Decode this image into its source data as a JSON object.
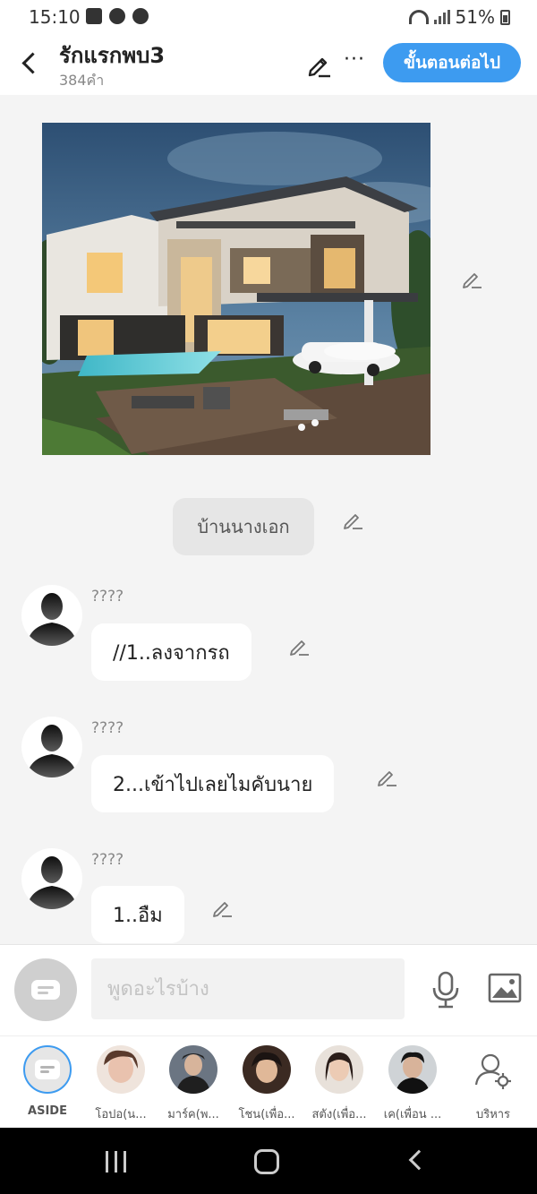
{
  "status": {
    "time": "15:10",
    "battery": "51%"
  },
  "header": {
    "title": "รักแรกพบ3",
    "subtitle": "384คำ",
    "more_label": "···",
    "next_label": "ขั้นตอนต่อไป"
  },
  "chat": {
    "narration": "บ้านนางเอก",
    "messages": [
      {
        "name": "????",
        "text": "//1..ลงจากรถ"
      },
      {
        "name": "????",
        "text": "2...เข้าไปเลยไมคับนาย"
      },
      {
        "name": "????",
        "text": "1..อืม"
      }
    ]
  },
  "input": {
    "placeholder": "พูดอะไรบ้าง"
  },
  "characters": [
    {
      "label": "ASIDE",
      "icon": "chat-bubble-icon",
      "active": true
    },
    {
      "label": "โอปอ(น...",
      "color": "#d8a48a"
    },
    {
      "label": "มาร์ค(พ...",
      "color": "#3a3a3a"
    },
    {
      "label": "โชน(เพื่อ...",
      "color": "#8a5c40"
    },
    {
      "label": "สตัง(เพื่อ...",
      "color": "#4a3a36"
    },
    {
      "label": "เค(เพื่อน ...",
      "color": "#2c2c2c"
    },
    {
      "label": "บริหาร",
      "icon": "manage-user-icon"
    }
  ],
  "colors": {
    "accent": "#3d9bf0",
    "bubble": "#ffffff",
    "background": "#f4f4f4"
  }
}
